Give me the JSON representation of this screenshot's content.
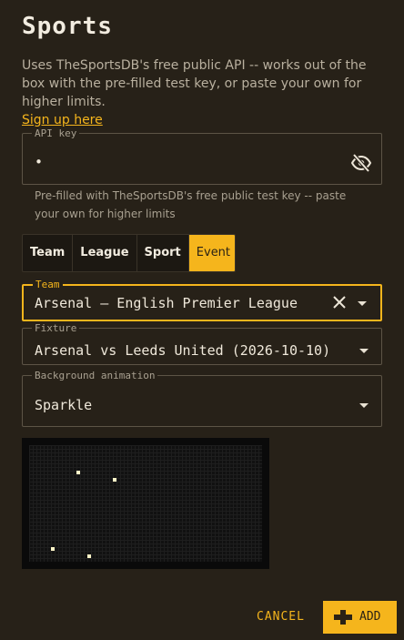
{
  "title": "Sports",
  "description": "Uses TheSportsDB's free public API -- works out of the box with the pre-filled test key, or paste your own for higher limits.",
  "signup_link": "Sign up here",
  "api_key": {
    "legend": "API key",
    "value": "•",
    "hint": "Pre-filled with TheSportsDB's free public test key -- paste your own for higher limits",
    "visibility_icon": "eye-off-icon"
  },
  "tabs": [
    {
      "label": "Team",
      "active": false
    },
    {
      "label": "League",
      "active": false
    },
    {
      "label": "Sport",
      "active": false
    },
    {
      "label": "Event",
      "active": true
    }
  ],
  "team_field": {
    "legend": "Team",
    "value": "Arsenal — English Premier League"
  },
  "fixture_field": {
    "legend": "Fixture",
    "value": "Arsenal vs Leeds United (2026-10-10)"
  },
  "animation_field": {
    "legend": "Background animation",
    "value": "Sparkle"
  },
  "buttons": {
    "cancel": "CANCEL",
    "add": "ADD"
  },
  "colors": {
    "accent": "#f5b51c",
    "background": "#272118",
    "border": "#5d5446"
  }
}
